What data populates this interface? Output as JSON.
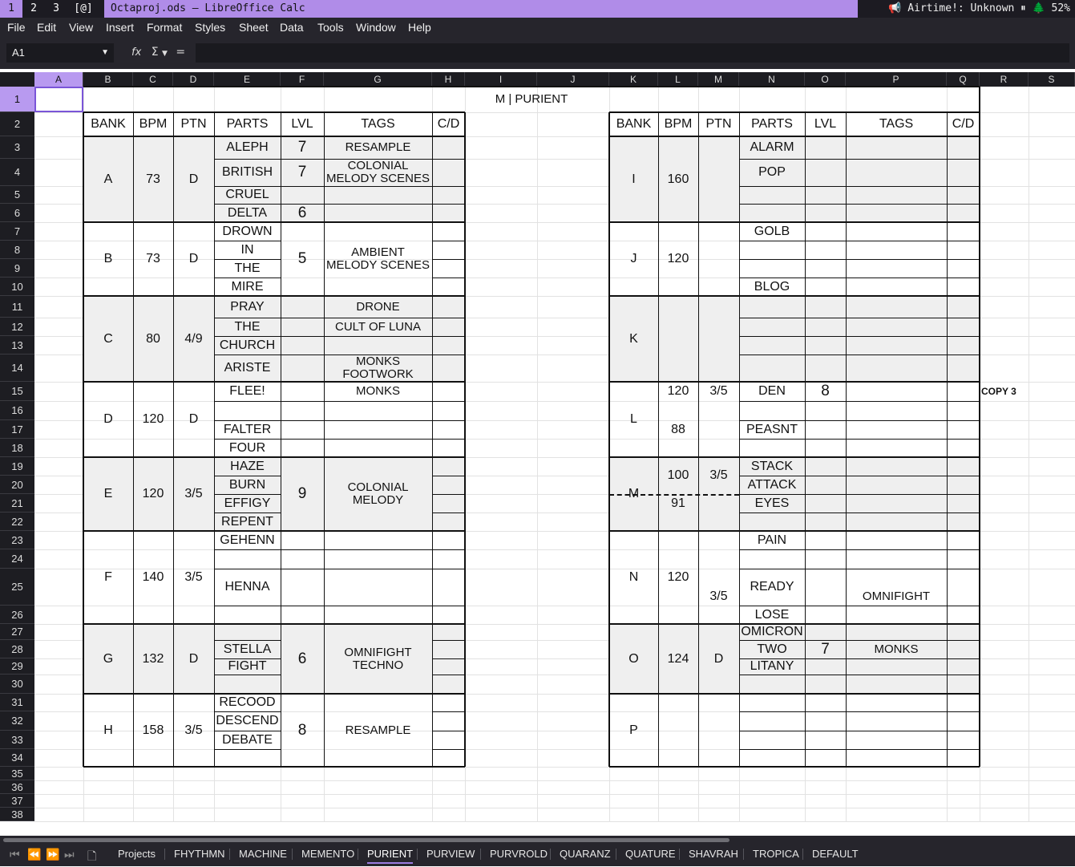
{
  "topbar": {
    "workspaces": [
      "1",
      "2",
      "3",
      "[@]"
    ],
    "window_title": "Octaproj.ods — LibreOffice Calc",
    "status_text": "📢 Airtime!: Unknown ⏸ 🌲 52%"
  },
  "menu": [
    "File",
    "Edit",
    "View",
    "Insert",
    "Format",
    "Styles",
    "Sheet",
    "Data",
    "Tools",
    "Window",
    "Help"
  ],
  "formula_bar": {
    "cell_ref": "A1",
    "func_icon": "fx",
    "sum_icon": "Σ",
    "equals": "=",
    "content": ""
  },
  "columns": [
    "A",
    "B",
    "C",
    "D",
    "E",
    "F",
    "G",
    "H",
    "I",
    "J",
    "K",
    "L",
    "M",
    "N",
    "O",
    "P",
    "Q",
    "R",
    "S"
  ],
  "rows": [
    "1",
    "2",
    "3",
    "4",
    "5",
    "6",
    "7",
    "8",
    "9",
    "10",
    "11",
    "12",
    "13",
    "14",
    "15",
    "16",
    "17",
    "18",
    "19",
    "20",
    "21",
    "22",
    "23",
    "24",
    "25",
    "26",
    "27",
    "28",
    "29",
    "30",
    "31",
    "32",
    "33",
    "34",
    "35",
    "36",
    "37",
    "38"
  ],
  "sheet": {
    "title": "M | PURIENT",
    "headers": [
      "BANK",
      "BPM",
      "PTN",
      "PARTS",
      "LVL",
      "TAGS",
      "C/D"
    ],
    "copy_note": "COPY 3",
    "left_banks": [
      {
        "bank": "A",
        "bpm": "73",
        "ptn": "D",
        "parts": [
          "ALEPH",
          "BRITISH",
          "CRUEL",
          "DELTA"
        ],
        "lvl": [
          "7",
          "7",
          "",
          "6"
        ],
        "tags": [
          "RESAMPLE",
          "COLONIAL\nMELODY SCENES",
          "",
          ""
        ]
      },
      {
        "bank": "B",
        "bpm": "73",
        "ptn": "D",
        "parts": [
          "DROWN",
          "IN",
          "THE",
          "MIRE"
        ],
        "lvl": "5",
        "tags": "AMBIENT\nMELODY SCENES"
      },
      {
        "bank": "C",
        "bpm": "80",
        "ptn": "4/9",
        "parts": [
          "PRAY",
          "THE",
          "CHURCH",
          "ARISTE"
        ],
        "tags": [
          "DRONE",
          "CULT OF LUNA",
          "",
          "MONKS\nFOOTWORK"
        ]
      },
      {
        "bank": "D",
        "bpm": "120",
        "ptn": "D",
        "parts": [
          "FLEE!",
          "",
          "FALTER",
          "FOUR"
        ],
        "tags": [
          "MONKS",
          "",
          "",
          ""
        ]
      },
      {
        "bank": "E",
        "bpm": "120",
        "ptn": "3/5",
        "parts": [
          "HAZE",
          "BURN",
          "EFFIGY",
          "REPENT"
        ],
        "lvl": "9",
        "tags": "COLONIAL\nMELODY"
      },
      {
        "bank": "F",
        "bpm": "140",
        "ptn": "3/5",
        "parts": [
          "GEHENN",
          "",
          "HENNA",
          ""
        ]
      },
      {
        "bank": "G",
        "bpm": "132",
        "ptn": "D",
        "parts": [
          "",
          "STELLA",
          "FIGHT",
          ""
        ],
        "lvl": "6",
        "tags": "OMNIFIGHT\nTECHNO"
      },
      {
        "bank": "H",
        "bpm": "158",
        "ptn": "3/5",
        "parts": [
          "RECOOD",
          "DESCEND",
          "DEBATE",
          ""
        ],
        "lvl": "8",
        "tags": "RESAMPLE"
      }
    ],
    "right_banks": [
      {
        "bank": "I",
        "bpm": "160",
        "parts": [
          "ALARM",
          "POP",
          "",
          ""
        ]
      },
      {
        "bank": "J",
        "bpm": "120",
        "parts": [
          "GOLB",
          "",
          "",
          "BLOG"
        ]
      },
      {
        "bank": "K"
      },
      {
        "bank": "L",
        "bpm": [
          "120",
          "",
          "88",
          ""
        ],
        "ptn": "3/5",
        "parts": [
          "DEN",
          "",
          "PEASNT",
          ""
        ],
        "lvl": "8"
      },
      {
        "bank": "M",
        "bpm": [
          "100",
          "91"
        ],
        "ptn": "3/5",
        "parts": [
          "STACK",
          "ATTACK",
          "EYES",
          ""
        ]
      },
      {
        "bank": "N",
        "bpm": "120",
        "ptn": "3/5",
        "parts": [
          "PAIN",
          "",
          "READY",
          "LOSE"
        ],
        "tags": "OMNIFIGHT"
      },
      {
        "bank": "O",
        "bpm": "124",
        "ptn": "D",
        "parts": [
          "OMICRON",
          "TWO",
          "LITANY",
          ""
        ],
        "lvl": "7",
        "tags": "MONKS"
      },
      {
        "bank": "P"
      }
    ]
  },
  "sheet_tabs": [
    "Projects",
    "FHYTHMN",
    "MACHINE",
    "MEMENTO",
    "PURIENT",
    "PURVIEW",
    "PURVROLD",
    "QUARANZ",
    "QUATURE",
    "SHAVRAH",
    "TROPICA",
    "DEFAULT"
  ],
  "active_tab": "PURIENT",
  "colors": {
    "accent": "#b08ce8",
    "chrome": "#26252c",
    "shade": "#efefef"
  }
}
